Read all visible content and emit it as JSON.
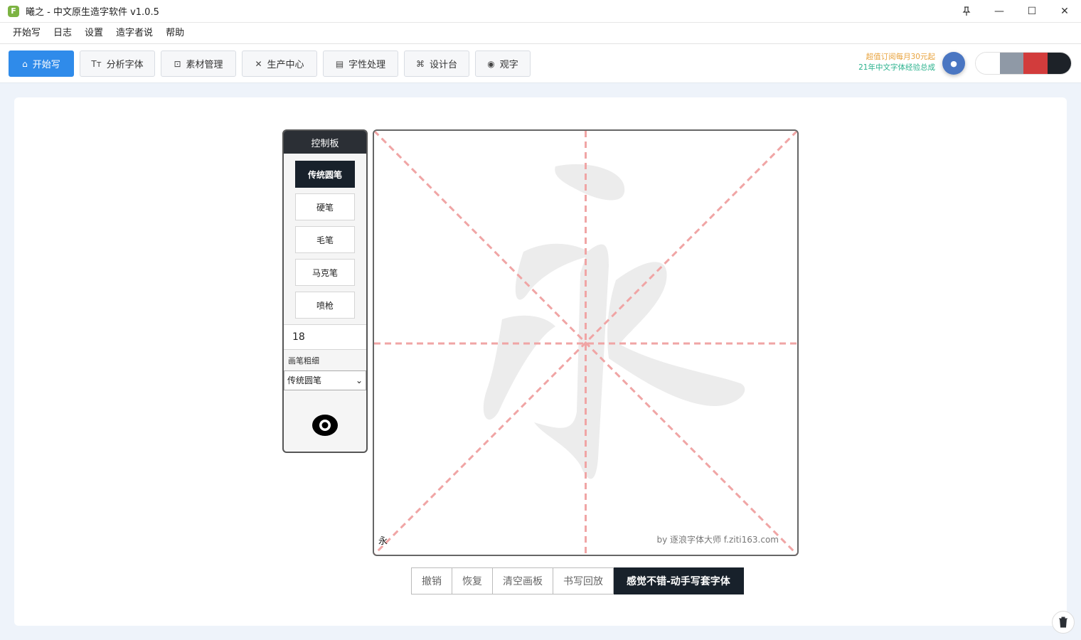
{
  "window": {
    "logo_letter": "F",
    "title": "曦之 - 中文原生造字软件 v1.0.5",
    "pin_icon": "📌",
    "min_icon": "—",
    "max_icon": "☐",
    "close_icon": "✕"
  },
  "menu": {
    "items": [
      "开始写",
      "日志",
      "设置",
      "造字者说",
      "帮助"
    ]
  },
  "toolbar": {
    "buttons": [
      {
        "label": "开始写",
        "icon": "⌂"
      },
      {
        "label": "分析字体",
        "icon": "Tт"
      },
      {
        "label": "素材管理",
        "icon": "⊡"
      },
      {
        "label": "生产中心",
        "icon": "✕"
      },
      {
        "label": "字性处理",
        "icon": "▤"
      },
      {
        "label": "设计台",
        "icon": "⌘"
      },
      {
        "label": "观字",
        "icon": "◉"
      }
    ],
    "promo_line1": "超值订阅每月30元起",
    "promo_line2": "21年中文字体经验总成",
    "avatar_glyph": "●"
  },
  "theme_colors": [
    "#ffffff",
    "#8f99a6",
    "#d23c3c",
    "#1d2228"
  ],
  "control_board": {
    "title": "控制板",
    "brushes": [
      "传统圆笔",
      "硬笔",
      "毛笔",
      "马克笔",
      "喷枪"
    ],
    "active_brush_index": 0,
    "size_value": "18",
    "size_label": "画笔粗细",
    "select_value": "传统圆笔",
    "select_arrow": "⌄"
  },
  "canvas": {
    "guide_char": "永",
    "watermark": "by 逐浪字体大师 f.ziti163.com",
    "grid_color": "#f0a5a5",
    "ghost_color": "#ececec"
  },
  "actions": {
    "undo": "撤销",
    "redo": "恢复",
    "clear": "清空画板",
    "replay": "书写回放",
    "cta": "感觉不错-动手写套字体"
  }
}
